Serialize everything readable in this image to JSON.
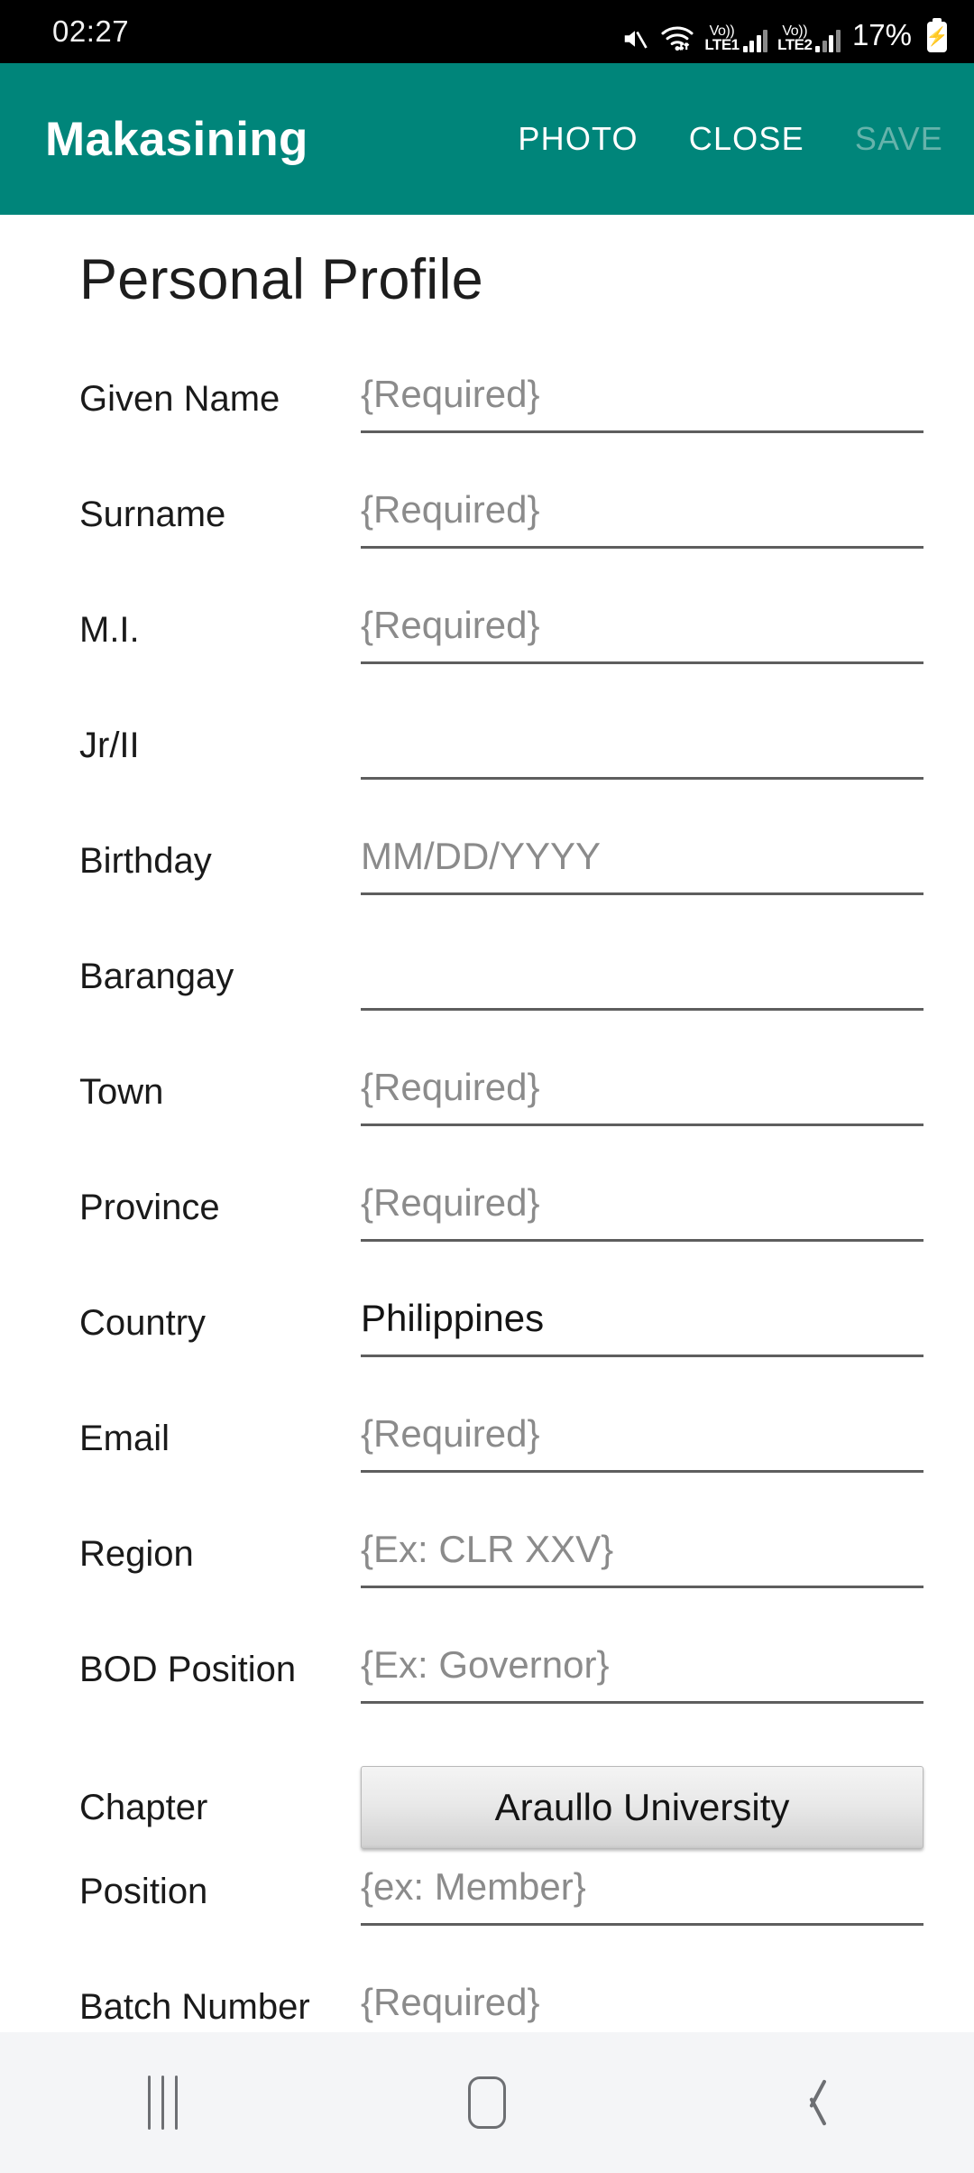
{
  "status_bar": {
    "time": "02:27",
    "battery_percent": "17%",
    "icons": [
      "mute-icon",
      "wifi-icon",
      "volte1-icon",
      "signal-bars-1-icon",
      "volte2-icon",
      "signal-bars-2-icon",
      "battery-charging-icon"
    ],
    "volte1_top": "Vo))",
    "volte1_bottom": "LTE1",
    "volte2_top": "Vo))",
    "volte2_bottom": "LTE2",
    "battery_bolt": "⚡"
  },
  "app_bar": {
    "title": "Makasining",
    "photo_label": "PHOTO",
    "close_label": "CLOSE",
    "save_label": "SAVE",
    "background_color": "#00857A",
    "save_disabled_color": "#66b3ab"
  },
  "page": {
    "title": "Personal Profile"
  },
  "form": {
    "fields": [
      {
        "label": "Given Name",
        "value": "{Required}",
        "state": "placeholder",
        "type": "text"
      },
      {
        "label": "Surname",
        "value": "{Required}",
        "state": "placeholder",
        "type": "text"
      },
      {
        "label": "M.I.",
        "value": "{Required}",
        "state": "placeholder",
        "type": "text"
      },
      {
        "label": "Jr/II",
        "value": "",
        "state": "placeholder",
        "type": "text"
      },
      {
        "label": "Birthday",
        "value": "MM/DD/YYYY",
        "state": "placeholder",
        "type": "text"
      },
      {
        "label": "Barangay",
        "value": "",
        "state": "placeholder",
        "type": "text"
      },
      {
        "label": "Town",
        "value": "{Required}",
        "state": "placeholder",
        "type": "text"
      },
      {
        "label": "Province",
        "value": "{Required}",
        "state": "placeholder",
        "type": "text"
      },
      {
        "label": "Country",
        "value": "Philippines",
        "state": "filled",
        "type": "text"
      },
      {
        "label": "Email",
        "value": "{Required}",
        "state": "placeholder",
        "type": "text"
      },
      {
        "label": "Region",
        "value": "{Ex: CLR XXV}",
        "state": "placeholder",
        "type": "text"
      },
      {
        "label": "BOD Position",
        "value": "{Ex: Governor}",
        "state": "placeholder",
        "type": "text"
      },
      {
        "label": "Chapter",
        "value": "Araullo University",
        "state": "filled",
        "type": "spinner"
      },
      {
        "label": "Position",
        "value": "{ex: Member}",
        "state": "placeholder",
        "type": "text"
      },
      {
        "label": "Batch Number",
        "value": "{Required}",
        "state": "placeholder",
        "type": "text"
      }
    ]
  },
  "nav_bar": {
    "recents_label": "recents-icon",
    "home_label": "home-icon",
    "back_label": "back-icon"
  }
}
